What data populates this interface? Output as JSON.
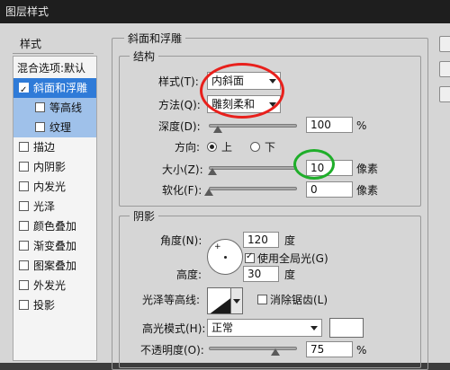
{
  "window": {
    "title": "图层样式"
  },
  "sidebar": {
    "header": "样式",
    "items": [
      {
        "label": "混合选项:默认",
        "checkbox": false,
        "checked": false,
        "state": "normal"
      },
      {
        "label": "斜面和浮雕",
        "checkbox": true,
        "checked": true,
        "state": "selected"
      },
      {
        "label": "等高线",
        "checkbox": true,
        "checked": false,
        "state": "sub"
      },
      {
        "label": "纹理",
        "checkbox": true,
        "checked": false,
        "state": "sub"
      },
      {
        "label": "描边",
        "checkbox": true,
        "checked": false,
        "state": "normal"
      },
      {
        "label": "内阴影",
        "checkbox": true,
        "checked": false,
        "state": "normal"
      },
      {
        "label": "内发光",
        "checkbox": true,
        "checked": false,
        "state": "normal"
      },
      {
        "label": "光泽",
        "checkbox": true,
        "checked": false,
        "state": "normal"
      },
      {
        "label": "颜色叠加",
        "checkbox": true,
        "checked": false,
        "state": "normal"
      },
      {
        "label": "渐变叠加",
        "checkbox": true,
        "checked": false,
        "state": "normal"
      },
      {
        "label": "图案叠加",
        "checkbox": true,
        "checked": false,
        "state": "normal"
      },
      {
        "label": "外发光",
        "checkbox": true,
        "checked": false,
        "state": "normal"
      },
      {
        "label": "投影",
        "checkbox": true,
        "checked": false,
        "state": "normal"
      }
    ]
  },
  "bevel": {
    "title": "斜面和浮雕",
    "structure": {
      "title": "结构",
      "style_label": "样式(T):",
      "style_value": "内斜面",
      "technique_label": "方法(Q):",
      "technique_value": "雕刻柔和",
      "depth_label": "深度(D):",
      "depth_value": "100",
      "depth_unit": "%",
      "direction_label": "方向:",
      "direction_up": "上",
      "direction_down": "下",
      "direction_selected": "up",
      "size_label": "大小(Z):",
      "size_value": "10",
      "size_unit": "像素",
      "soften_label": "软化(F):",
      "soften_value": "0",
      "soften_unit": "像素"
    },
    "shading": {
      "title": "阴影",
      "angle_label": "角度(N):",
      "angle_value": "120",
      "angle_unit": "度",
      "global_light_label": "使用全局光(G)",
      "global_light_checked": true,
      "altitude_label": "高度:",
      "altitude_value": "30",
      "altitude_unit": "度",
      "gloss_label": "光泽等高线:",
      "antialias_label": "消除锯齿(L)",
      "antialias_checked": false,
      "highlight_mode_label": "高光模式(H):",
      "highlight_mode_value": "正常",
      "highlight_color": "#ffffff",
      "opacity_label": "不透明度(O):",
      "opacity_value": "75",
      "opacity_unit": "%"
    }
  },
  "annotations": {
    "red_circle_color": "#e8201c",
    "green_circle_color": "#1fae2a"
  }
}
